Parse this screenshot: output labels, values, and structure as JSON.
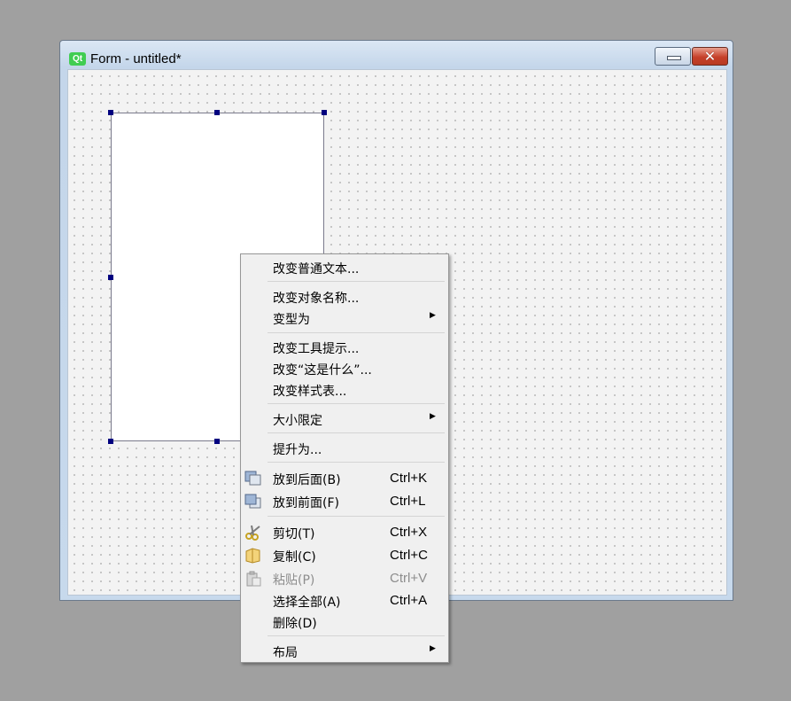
{
  "window": {
    "logo_text": "Qt",
    "title": "Form - untitled*",
    "minimize_glyph": "",
    "close_glyph": "✕"
  },
  "menu": {
    "items": [
      {
        "label": "改变普通文本..."
      },
      {
        "label": "改变对象名称..."
      },
      {
        "label": "变型为",
        "submenu": "▶"
      },
      {
        "label": "改变工具提示..."
      },
      {
        "label": "改变“这是什么”..."
      },
      {
        "label": "改变样式表..."
      },
      {
        "label": "大小限定",
        "submenu": "▶"
      },
      {
        "label": "提升为..."
      },
      {
        "label": "放到后面(B)",
        "shortcut": "Ctrl+K",
        "icon": "send-to-back-icon"
      },
      {
        "label": "放到前面(F)",
        "shortcut": "Ctrl+L",
        "icon": "bring-to-front-icon"
      },
      {
        "label": "剪切(T)",
        "shortcut": "Ctrl+X",
        "icon": "scissors-icon"
      },
      {
        "label": "复制(C)",
        "shortcut": "Ctrl+C",
        "icon": "copy-icon"
      },
      {
        "label": "粘贴(P)",
        "shortcut": "Ctrl+V",
        "icon": "paste-icon",
        "disabled": true
      },
      {
        "label": "选择全部(A)",
        "shortcut": "Ctrl+A"
      },
      {
        "label": "删除(D)"
      },
      {
        "label": "布局",
        "submenu": "▶"
      }
    ]
  },
  "colors": {
    "handle": "#00007f",
    "qt_green": "#41cd52",
    "disabled_text": "#8d8d8d"
  }
}
